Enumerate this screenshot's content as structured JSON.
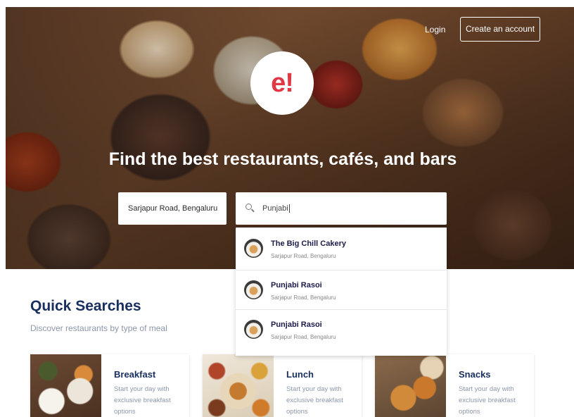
{
  "header": {
    "login_label": "Login",
    "create_account_label": "Create an account"
  },
  "logo": {
    "text": "e!"
  },
  "hero": {
    "headline": "Find the best restaurants, cafés, and bars"
  },
  "search": {
    "location_value": "Sarjapur Road, Bengaluru",
    "query_value": "Punjabi"
  },
  "suggestions": [
    {
      "name": "The Big Chill Cakery",
      "address": "Sarjapur Road, Bengaluru"
    },
    {
      "name": "Punjabi Rasoi",
      "address": "Sarjapur Road, Bengaluru"
    },
    {
      "name": "Punjabi Rasoi",
      "address": "Sarjapur Road, Bengaluru"
    }
  ],
  "quick_searches": {
    "title": "Quick Searches",
    "subtitle": "Discover restaurants by type of meal",
    "cards": [
      {
        "title": "Breakfast",
        "description": "Start your day with exclusive breakfast options"
      },
      {
        "title": "Lunch",
        "description": "Start your day with exclusive breakfast options"
      },
      {
        "title": "Snacks",
        "description": "Start your day with exclusive breakfast options"
      }
    ]
  },
  "colors": {
    "brand_red": "#e23744",
    "heading_navy": "#192f60",
    "muted_text": "#8c96ab"
  }
}
